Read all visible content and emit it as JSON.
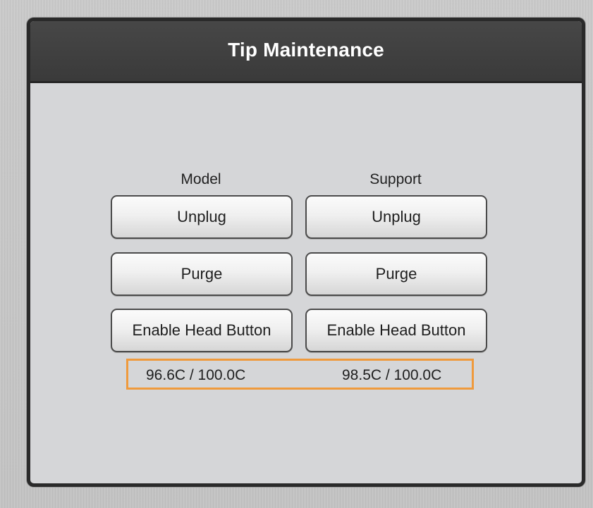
{
  "dialog": {
    "title": "Tip Maintenance"
  },
  "columns": [
    {
      "header": "Model",
      "buttons": {
        "unplug": "Unplug",
        "purge": "Purge",
        "enable_head": "Enable Head Button"
      },
      "temperature": "96.6C / 100.0C"
    },
    {
      "header": "Support",
      "buttons": {
        "unplug": "Unplug",
        "purge": "Purge",
        "enable_head": "Enable Head Button"
      },
      "temperature": "98.5C / 100.0C"
    }
  ],
  "colors": {
    "titlebar": "#3f3f3f",
    "panel": "#d5d6d8",
    "highlight": "#ef9a3c"
  }
}
